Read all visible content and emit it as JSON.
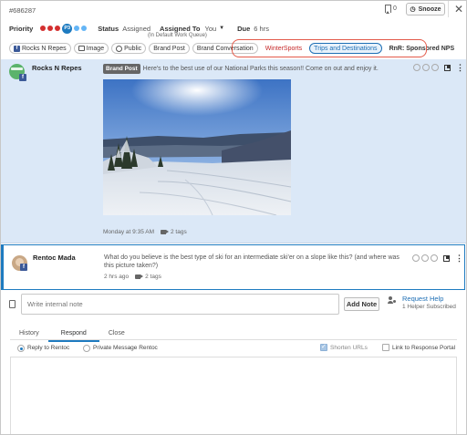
{
  "header": {
    "ticket_id": "#686287",
    "bookmark_count": "0",
    "snooze_label": "Snooze",
    "close_label": "✕",
    "priority_label": "Priority",
    "priority_badge": "P3",
    "status_label": "Status",
    "status_value": "Assigned",
    "assigned_label": "Assigned To",
    "assigned_value": "You",
    "assigned_sub": "(In Default Work Queue)",
    "due_label": "Due",
    "due_value": "6 hrs"
  },
  "tags": [
    {
      "label": "Rocks N Repes",
      "icon": "facebook-icon"
    },
    {
      "label": "Image",
      "icon": "image-icon"
    },
    {
      "label": "Public",
      "icon": "globe-icon"
    },
    {
      "label": "Brand Post"
    },
    {
      "label": "Brand Conversation"
    },
    {
      "label": "WinterSports",
      "style": "red"
    },
    {
      "label": "Trips and Destinations",
      "style": "blue"
    },
    {
      "label": "RnR: Sponsored NPS",
      "style": "bold"
    }
  ],
  "post1": {
    "author": "Rocks N Repes",
    "badge": "Brand Post",
    "text": "Here's to the best use of our National Parks this season!! Come on out and enjoy it.",
    "time": "Monday at 9:35 AM",
    "tags": "2 tags"
  },
  "post2": {
    "author": "Rentoc Mada",
    "text": "What do you believe is the best type of ski for an intermediate ski'er on a slope like this? (and where was this picture taken?)",
    "time": "2 hrs ago",
    "tags": "2 tags"
  },
  "note": {
    "placeholder": "Write internal note",
    "add_label": "Add Note",
    "request_help": "Request Help",
    "helper_subscribed": "1 Helper Subscribed"
  },
  "tabs": [
    "History",
    "Respond",
    "Close"
  ],
  "respond": {
    "reply_to": "Reply to Rentoc",
    "private_msg": "Private Message Rentoc",
    "shorten_urls": "Shorten URLs",
    "link_portal": "Link to Response Portal"
  },
  "colors": {
    "accent": "#1e7bc0",
    "highlight": "#e35a4a",
    "post_bg": "#dbe8f7",
    "priority_dots": [
      "#d32f2f",
      "#d32f2f",
      "#d32f2f",
      "#64b5f6",
      "#64b5f6"
    ]
  }
}
